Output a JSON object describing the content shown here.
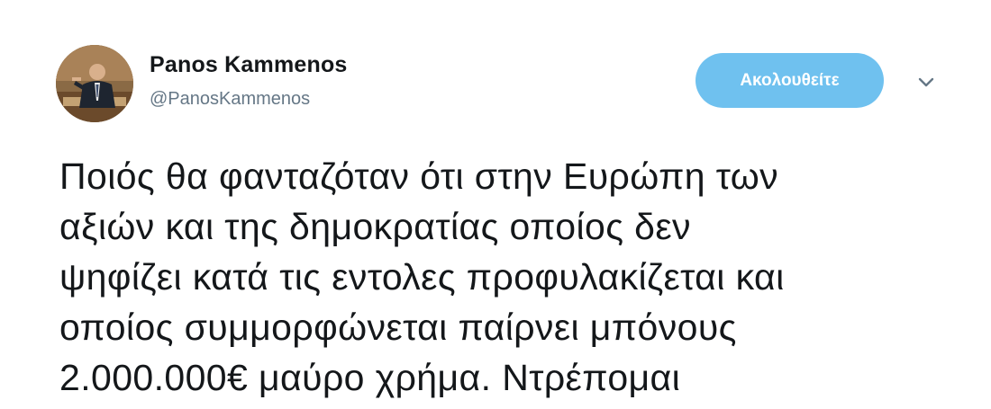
{
  "author": {
    "display_name": "Panos Kammenos",
    "handle": "@PanosKammenos"
  },
  "follow_button": {
    "label": "Ακολουθείτε",
    "color": "#6fc1ef"
  },
  "menu": {
    "icon": "chevron-down-icon"
  },
  "tweet": {
    "lines": [
      "Ποιός θα φανταζόταν ότι στην Ευρώπη των",
      "αξιών και της δημοκρατίας οποίος δεν",
      "ψηφίζει κατά τις εντολες προφυλακίζεται και",
      "οποίος συμμορφώνεται παίρνει μπόνους",
      "2.000.000€ μαύρο χρήμα. Ντρέπομαι"
    ]
  }
}
